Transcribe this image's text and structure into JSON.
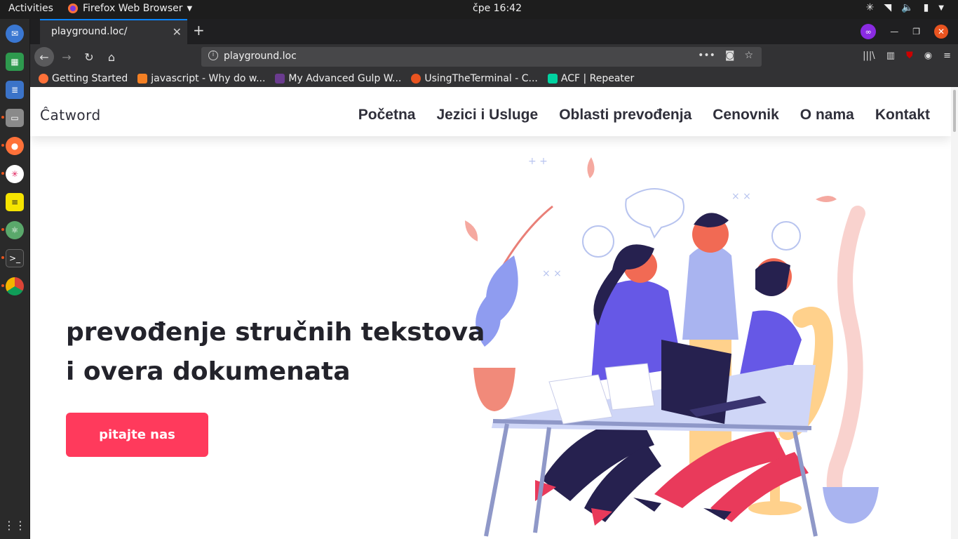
{
  "topbar": {
    "activities": "Activities",
    "app_name": "Firefox Web Browser",
    "clock": "čpe 16:42"
  },
  "browser": {
    "tab_title": "playground.loc/",
    "url": "playground.loc",
    "bookmarks": [
      {
        "label": "Getting Started",
        "color": "#ff7139"
      },
      {
        "label": "javascript - Why do w...",
        "color": "#f48024"
      },
      {
        "label": "My Advanced Gulp W...",
        "color": "#6a3b8f"
      },
      {
        "label": "UsingTheTerminal - C...",
        "color": "#e95420"
      },
      {
        "label": "ACF | Repeater",
        "color": "#00d3a1"
      }
    ]
  },
  "site": {
    "logo": "Ĉatword",
    "menu": [
      "Početna",
      "Jezici i Usluge",
      "Oblasti prevođenja",
      "Cenovnik",
      "O nama",
      "Kontakt"
    ],
    "hero_line1": "prevođenje stručnih tekstova",
    "hero_line2": "i overa dokumenata",
    "cta": "pitajte nas",
    "accent": "#ff3a5c"
  }
}
